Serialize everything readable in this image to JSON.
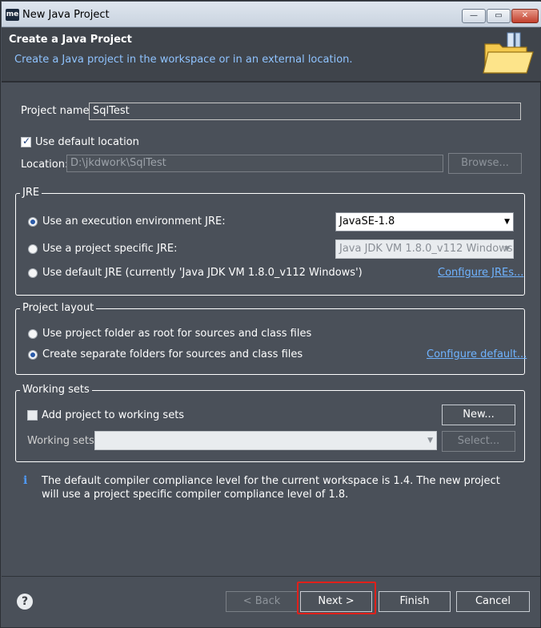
{
  "window": {
    "app_icon": "me",
    "title": "New Java Project",
    "controls": {
      "minimize": "—",
      "maximize": "▭",
      "close": "✕"
    }
  },
  "banner": {
    "title": "Create a Java Project",
    "description": "Create a Java project in the workspace or in an external location.",
    "icon": "java-project-folder-icon"
  },
  "project": {
    "name_label": "Project name:",
    "name_value": "SqlTest",
    "use_default_location_label": "Use default location",
    "use_default_location_checked": true,
    "location_label": "Location:",
    "location_value": "D:\\jkdwork\\SqlTest",
    "browse_button": "Browse..."
  },
  "jre": {
    "group_title": "JRE",
    "options": [
      {
        "label": "Use an execution environment JRE:",
        "selected": true
      },
      {
        "label": "Use a project specific JRE:",
        "selected": false
      },
      {
        "label": "Use default JRE (currently 'Java JDK VM 1.8.0_v112 Windows')",
        "selected": false
      }
    ],
    "execution_env_value": "JavaSE-1.8",
    "project_specific_value": "Java JDK VM 1.8.0_v112 Windows",
    "configure_link": "Configure JREs..."
  },
  "layout": {
    "group_title": "Project layout",
    "options": [
      {
        "label": "Use project folder as root for sources and class files",
        "selected": false
      },
      {
        "label": "Create separate folders for sources and class files",
        "selected": true
      }
    ],
    "configure_link": "Configure default..."
  },
  "working_sets": {
    "group_title": "Working sets",
    "add_label": "Add project to working sets",
    "add_checked": false,
    "new_button": "New...",
    "working_sets_label": "Working sets:",
    "working_sets_value": "",
    "select_button": "Select..."
  },
  "info": {
    "icon": "info-icon",
    "message": "The default compiler compliance level for the current workspace is 1.4. The new project will use a project specific compiler compliance level of 1.8."
  },
  "footer": {
    "help_icon": "?",
    "back_button": "< Back",
    "next_button": "Next >",
    "finish_button": "Finish",
    "cancel_button": "Cancel"
  },
  "colors": {
    "dialog_bg": "#4a5059",
    "banner_bg": "#3f444b",
    "link": "#6fb3ff",
    "highlight": "#e0201a"
  }
}
